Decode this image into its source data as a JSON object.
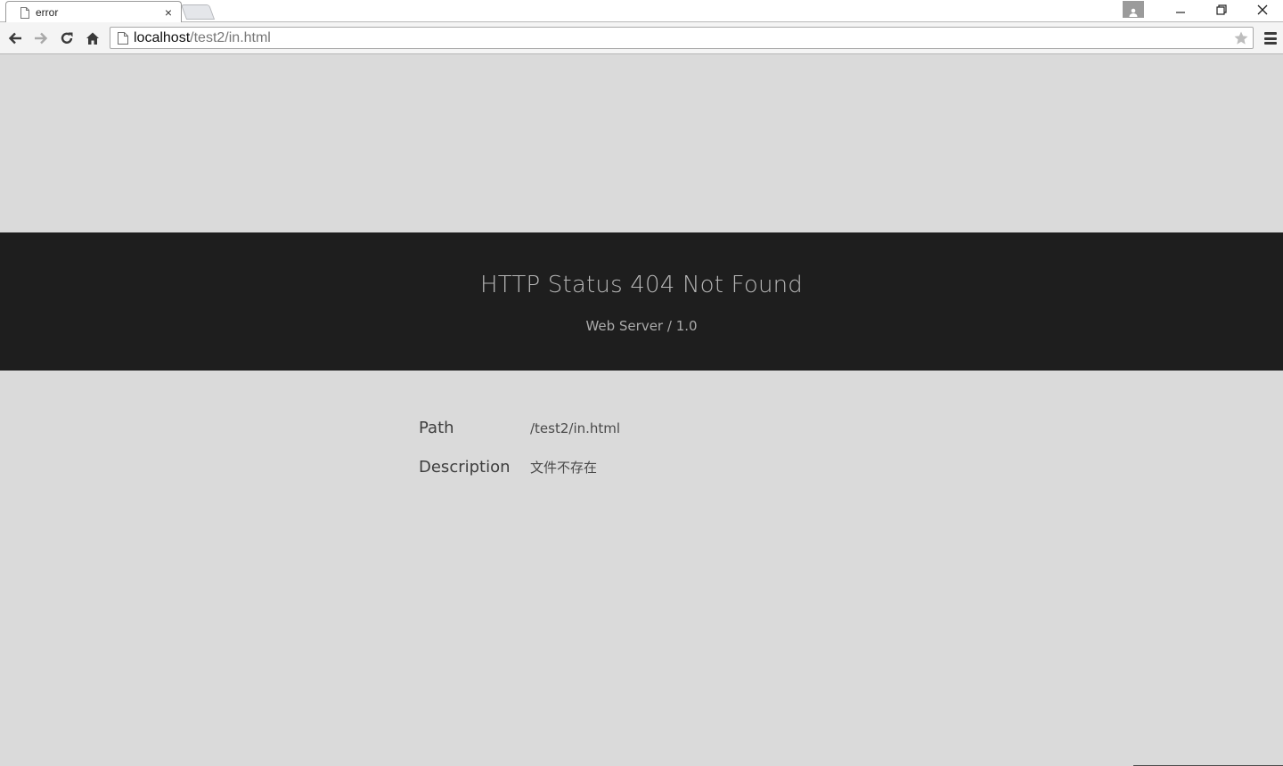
{
  "browser": {
    "tab": {
      "title": "error",
      "close_glyph": "×"
    },
    "address": {
      "host": "localhost",
      "path": "/test2/in.html"
    },
    "icons": {
      "tab_page": "page-icon",
      "back": "arrow-left-icon",
      "forward": "arrow-right-icon",
      "reload": "reload-icon",
      "home": "home-icon",
      "bookmark": "star-icon",
      "menu": "hamburger-icon",
      "profile": "person-icon",
      "minimize": "minimize-icon",
      "restore": "restore-icon",
      "close": "close-icon"
    }
  },
  "error_page": {
    "title": "HTTP Status 404 Not Found",
    "server": "Web Server / 1.0",
    "details": [
      {
        "label": "Path",
        "value": "/test2/in.html"
      },
      {
        "label": "Description",
        "value": "文件不存在"
      }
    ]
  },
  "colors": {
    "page_background": "#dadada",
    "banner_background": "#1e1e1e",
    "title_text": "#b6b6b6"
  }
}
